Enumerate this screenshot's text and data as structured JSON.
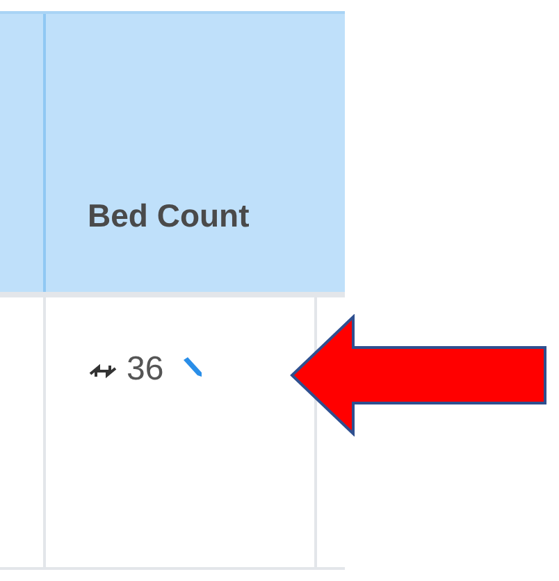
{
  "table": {
    "columns": [
      {
        "label": "Bed Count"
      }
    ],
    "rows": [
      {
        "value": "36"
      }
    ]
  }
}
